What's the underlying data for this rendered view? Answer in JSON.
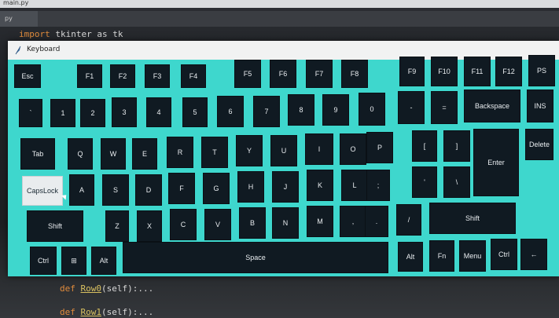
{
  "ide": {
    "title": "main.py",
    "tab": "py",
    "import_keyword": "import",
    "import_rest": " tkinter as tk",
    "def_lines": [
      {
        "def": "def",
        "name": "Row0",
        "rest": "(self):..."
      },
      {
        "def": "def",
        "name": "Row1",
        "rest": "(self):..."
      }
    ]
  },
  "window": {
    "title": "Keyboard",
    "icon": "feather-icon"
  },
  "rows": {
    "row0": [
      "Esc",
      "F1",
      "F2",
      "F3",
      "F4",
      "F5",
      "F6",
      "F7",
      "F8",
      "F9",
      "F10",
      "F11",
      "F12",
      "PS"
    ],
    "row1": [
      "`",
      "1",
      "2",
      "3",
      "4",
      "5",
      "6",
      "7",
      "8",
      "9",
      "0",
      "-",
      "=",
      "Backspace",
      "INS"
    ],
    "row2": [
      "Tab",
      "Q",
      "W",
      "E",
      "R",
      "T",
      "Y",
      "U",
      "I",
      "O",
      "P",
      "[",
      "]",
      "Enter",
      "Delete"
    ],
    "row3": [
      "CapsLock",
      "A",
      "S",
      "D",
      "F",
      "G",
      "H",
      "J",
      "K",
      "L",
      ";",
      "'",
      "\\"
    ],
    "row4": [
      "Shift",
      "Z",
      "X",
      "C",
      "V",
      "B",
      "N",
      "M",
      ",",
      ".",
      "/",
      "Shift"
    ],
    "row5": [
      "Ctrl",
      "⊞",
      "Alt",
      "Space",
      "Alt",
      "Fn",
      "Menu",
      "Ctrl",
      "←"
    ]
  },
  "active_key": "CapsLock",
  "colors": {
    "window_bg": "#3ed7cd",
    "key_bg": "#101a22",
    "key_text": "#e8ecef",
    "active_key_bg": "#e9ecee"
  }
}
